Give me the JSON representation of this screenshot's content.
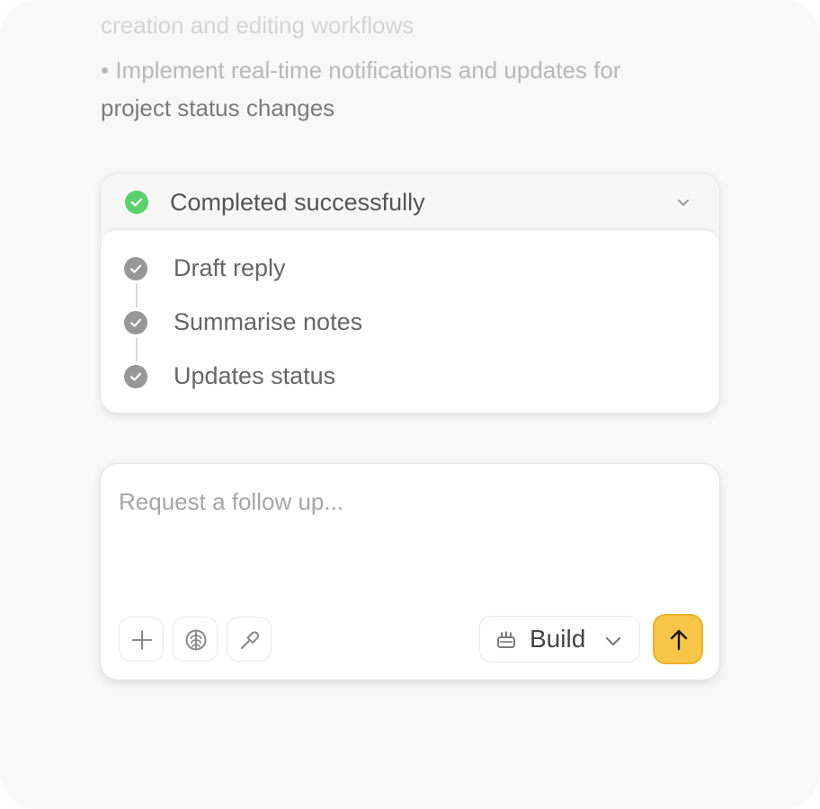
{
  "message": {
    "lines": [
      "creation and editing workflows",
      "• Implement real-time notifications and updates for",
      "project status changes"
    ]
  },
  "task": {
    "status_text": "Completed successfully",
    "status_color": "#5bd16e",
    "steps": [
      {
        "label": "Draft reply",
        "icon": "check-circle-icon"
      },
      {
        "label": "Summarise notes",
        "icon": "check-circle-icon"
      },
      {
        "label": "Updates status",
        "icon": "check-circle-icon"
      }
    ]
  },
  "composer": {
    "placeholder": "Request a follow up...",
    "value": "",
    "tools": [
      "plus-icon",
      "brain-icon",
      "hammer-icon"
    ],
    "mode": {
      "label": "Build",
      "icon": "build-icon"
    },
    "send_color": "#f6c54a"
  }
}
